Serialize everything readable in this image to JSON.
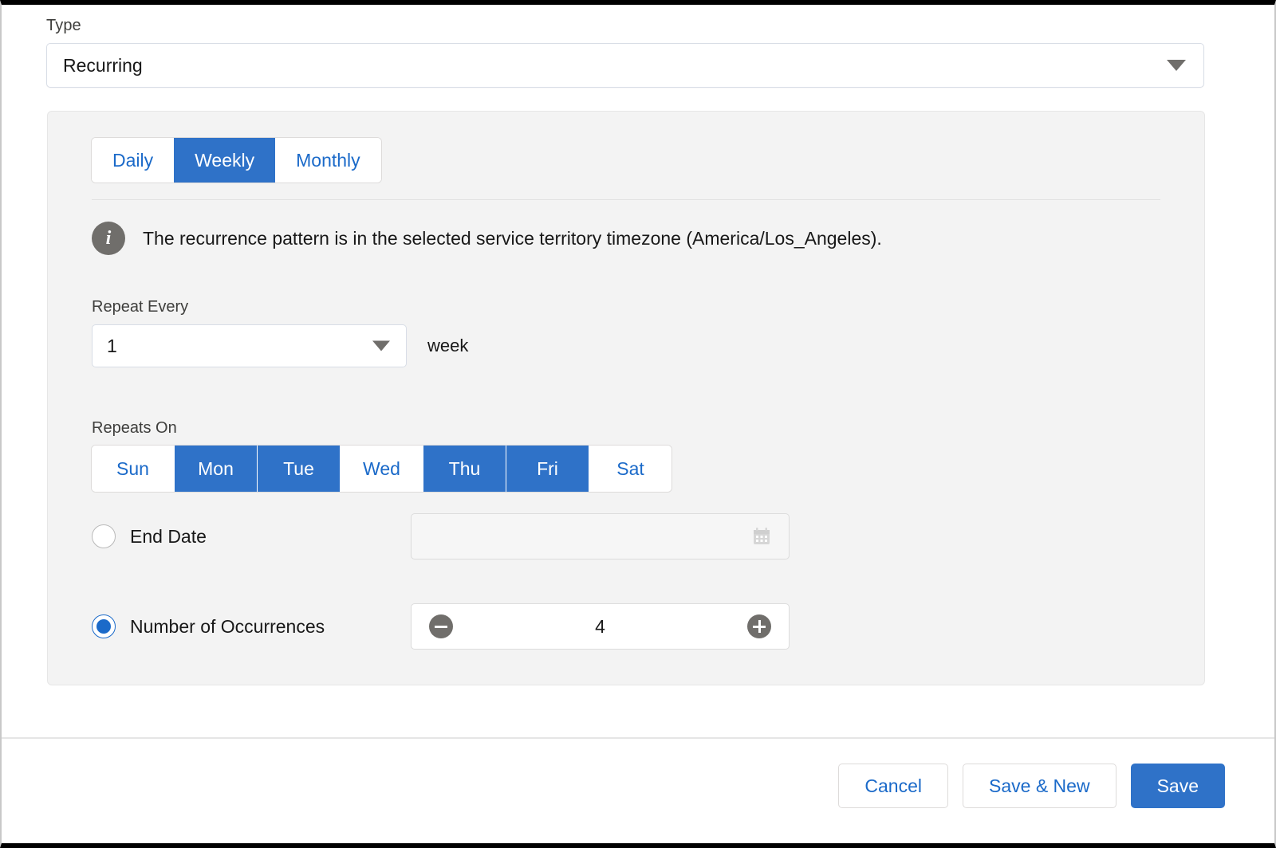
{
  "type_field": {
    "label": "Type",
    "value": "Recurring",
    "caret_icon": "chevron-down-icon"
  },
  "recurrence": {
    "tabs": [
      {
        "label": "Daily",
        "selected": false
      },
      {
        "label": "Weekly",
        "selected": true
      },
      {
        "label": "Monthly",
        "selected": false
      }
    ],
    "info": {
      "icon": "info-icon",
      "text": "The recurrence pattern is in the selected service territory timezone (America/Los_Angeles)."
    },
    "repeat_every": {
      "label": "Repeat Every",
      "value": "1",
      "unit": "week",
      "caret_icon": "chevron-down-icon"
    },
    "repeats_on": {
      "label": "Repeats On",
      "days": [
        {
          "label": "Sun",
          "selected": false
        },
        {
          "label": "Mon",
          "selected": true
        },
        {
          "label": "Tue",
          "selected": true
        },
        {
          "label": "Wed",
          "selected": false
        },
        {
          "label": "Thu",
          "selected": true
        },
        {
          "label": "Fri",
          "selected": true
        },
        {
          "label": "Sat",
          "selected": false
        }
      ]
    },
    "end_date": {
      "label": "End Date",
      "selected": false,
      "value": "",
      "placeholder": "",
      "calendar_icon": "calendar-icon"
    },
    "occurrences": {
      "label": "Number of Occurrences",
      "selected": true,
      "value": "4",
      "decrement_icon": "minus-circle-icon",
      "increment_icon": "plus-circle-icon"
    }
  },
  "footer": {
    "cancel_label": "Cancel",
    "save_new_label": "Save & New",
    "save_label": "Save"
  },
  "colors": {
    "brand_blue": "#2f72c8",
    "link_blue": "#1b6ac9",
    "panel_gray": "#f3f3f3",
    "icon_gray": "#706e6b"
  }
}
